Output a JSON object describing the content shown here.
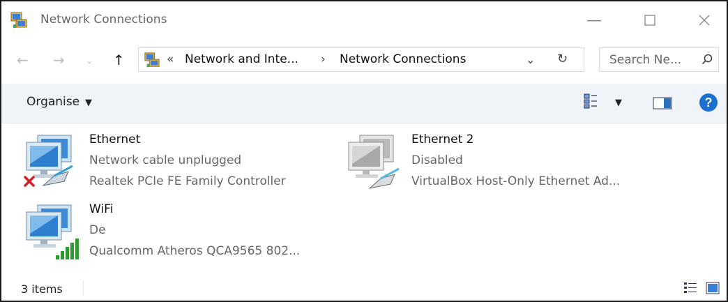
{
  "window": {
    "title": "Network Connections"
  },
  "address_bar": {
    "overflow": "«",
    "crumbs": [
      "Network and Inte...",
      "Network Connections"
    ],
    "separator": "›"
  },
  "search": {
    "placeholder": "Search Ne..."
  },
  "command_bar": {
    "organise_label": "Organise"
  },
  "items": [
    {
      "name": "Ethernet",
      "status": "Network cable unplugged",
      "device": "Realtek PCIe FE Family Controller",
      "icon": "network-adapter-disconnected-icon"
    },
    {
      "name": "Ethernet 2",
      "status": "Disabled",
      "device": "VirtualBox Host-Only Ethernet Ad...",
      "icon": "network-adapter-disabled-icon"
    },
    {
      "name": "WiFi",
      "status": "De",
      "device": "Qualcomm Atheros QCA9565 802...",
      "icon": "wifi-adapter-icon"
    }
  ],
  "status_bar": {
    "count": "3 items"
  },
  "colors": {
    "accent": "#1a6fd1",
    "error": "#d32020",
    "wifi_bars": "#2e9b2e"
  }
}
